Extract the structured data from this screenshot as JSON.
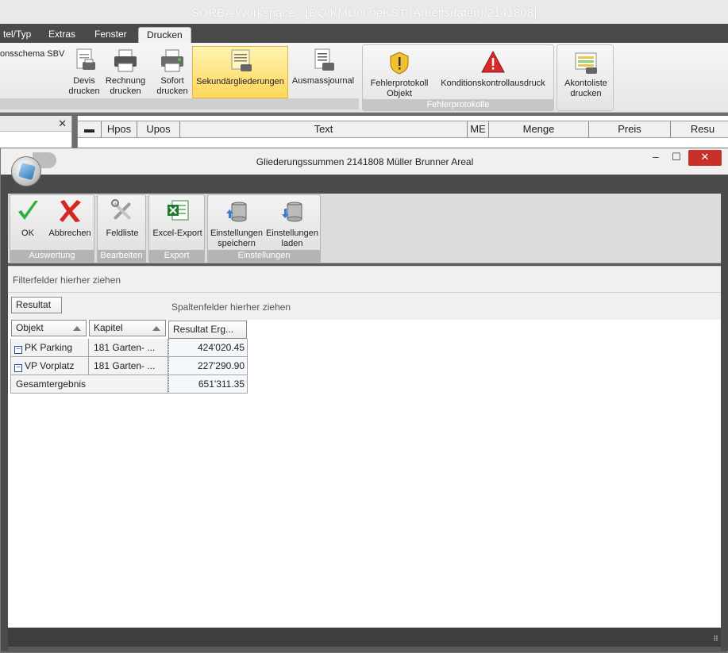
{
  "app": {
    "title": "SORBA Workspace - [DQ/KMUohneKST (Arbeitsdaten)/2141808]"
  },
  "main_tabs": [
    {
      "label": "tel/Typ"
    },
    {
      "label": "Extras"
    },
    {
      "label": "Fenster"
    },
    {
      "label": "Drucken"
    }
  ],
  "ribbon": {
    "schema_label": "onsschema SBV",
    "buttons": {
      "devis": "Devis\ndrucken",
      "rechnung": "Rechnung\ndrucken",
      "sofort": "Sofort\ndrucken",
      "sekundaer": "Sekundärgliederungen",
      "ausmass": "Ausmassjournal",
      "fehlerprotokoll": "Fehlerprotokoll\nObjekt",
      "kondition": "Konditionskontrollausdruck",
      "akonto": "Akontoliste\ndrucken"
    },
    "group_fehler": "Fehlerprotokolle"
  },
  "grid_columns": [
    "Hpos",
    "Upos",
    "Text",
    "ME",
    "Menge",
    "Preis",
    "Resu"
  ],
  "dialog": {
    "title": "Gliederungssummen 2141808 Müller Brunner Areal",
    "toolbar": {
      "ok": "OK",
      "abbrechen": "Abbrechen",
      "feldliste": "Feldliste",
      "excel_export": "Excel-Export",
      "einst_speichern": "Einstellungen\nspeichern",
      "einst_laden": "Einstellungen\nladen",
      "groups": {
        "auswertung": "Auswertung",
        "bearbeiten": "Bearbeiten",
        "export": "Export",
        "einstellungen": "Einstellungen"
      }
    },
    "pivot": {
      "filter_hint": "Filterfelder hierher ziehen",
      "data_field": "Resultat",
      "column_hint": "Spaltenfelder hierher ziehen",
      "row_fields": [
        "Objekt",
        "Kapitel"
      ],
      "value_header": "Resultat Erg...",
      "rows": [
        {
          "objekt": "PK Parking",
          "kapitel": "181 Garten- ...",
          "value": "424'020.45"
        },
        {
          "objekt": "VP Vorplatz",
          "kapitel": "181 Garten- ...",
          "value": "227'290.90"
        }
      ],
      "total_label": "Gesamtergebnis",
      "total_value": "651'311.35"
    }
  }
}
